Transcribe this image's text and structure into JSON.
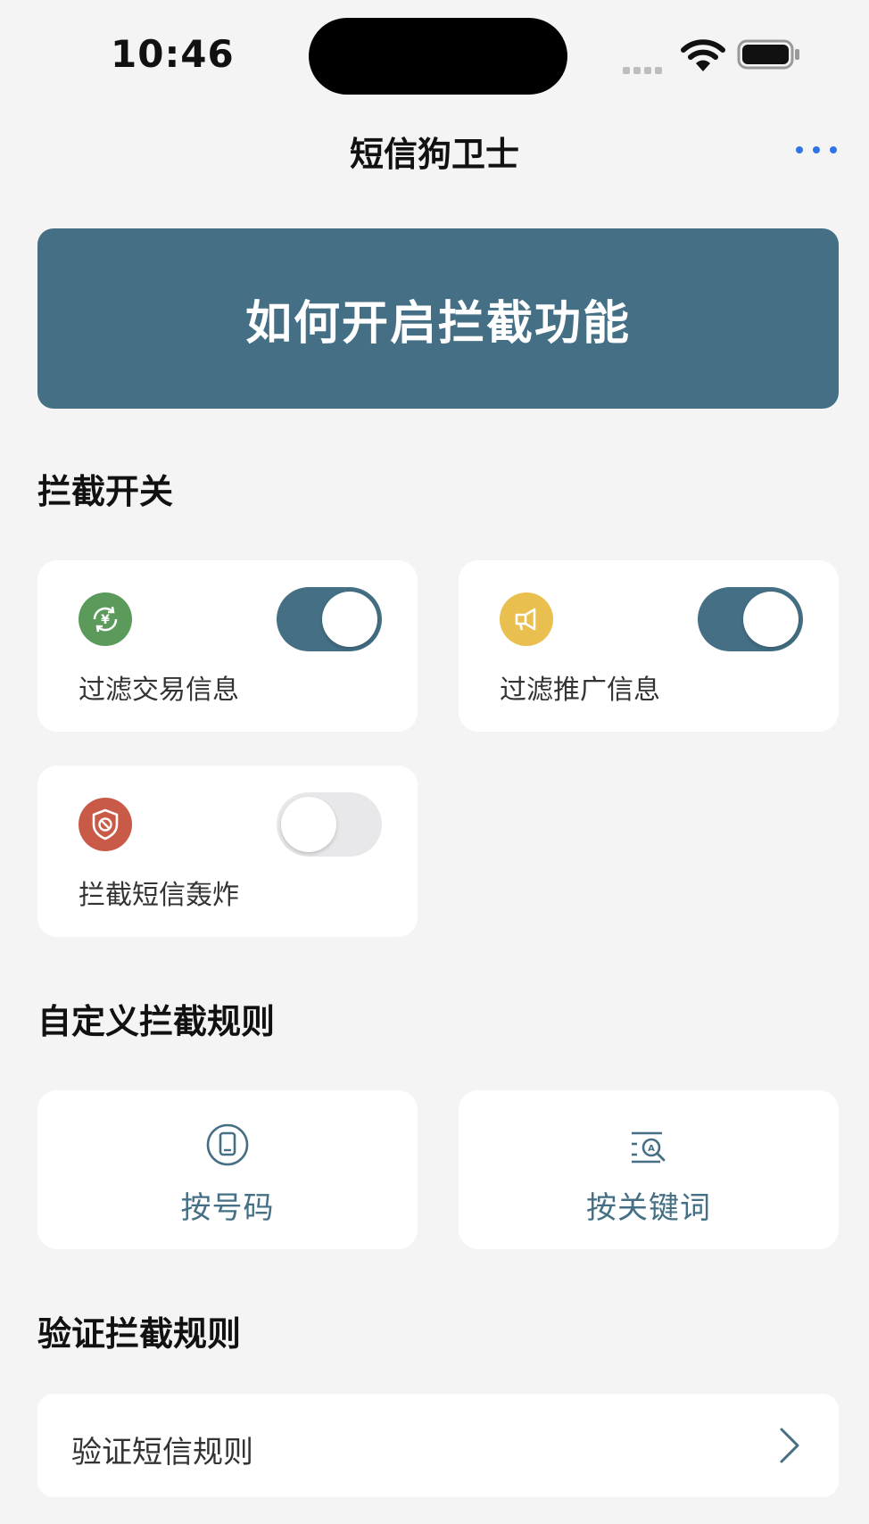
{
  "status": {
    "time": "10:46"
  },
  "nav": {
    "title": "短信狗卫士",
    "more_icon": "more-dots-icon"
  },
  "banner": {
    "label": "如何开启拦截功能",
    "color": "#446f84"
  },
  "sections": {
    "switches_title": "拦截开关",
    "custom_title": "自定义拦截规则",
    "verify_title": "验证拦截规则"
  },
  "switches": [
    {
      "label": "过滤交易信息",
      "icon": "yen-exchange-icon",
      "icon_color": "#5b9a5a",
      "enabled": true
    },
    {
      "label": "过滤推广信息",
      "icon": "megaphone-icon",
      "icon_color": "#e9bf4f",
      "enabled": true
    },
    {
      "label": "拦截短信轰炸",
      "icon": "shield-block-icon",
      "icon_color": "#c85a47",
      "enabled": false
    }
  ],
  "rules": [
    {
      "label": "按号码",
      "icon": "phone-icon"
    },
    {
      "label": "按关键词",
      "icon": "keyword-search-icon"
    }
  ],
  "verify": {
    "label": "验证短信规则",
    "icon": "chevron-right-icon"
  },
  "colors": {
    "accent": "#446f84",
    "link": "#2f74e5",
    "background": "#f4f4f5"
  }
}
